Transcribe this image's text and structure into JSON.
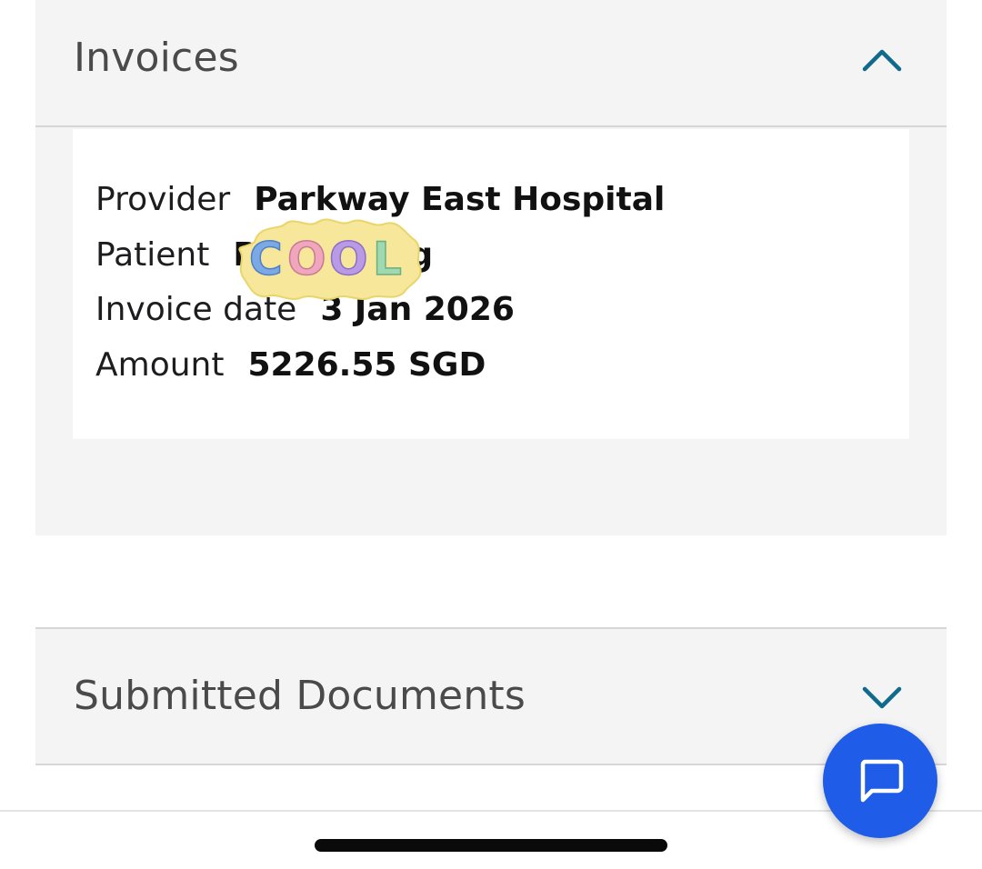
{
  "invoices_section": {
    "title": "Invoices",
    "expanded": true,
    "toggle_icon": "chevron-up-icon",
    "invoice": {
      "provider_label": "Provider",
      "provider_value": "Parkway East Hospital",
      "patient_label": "Patient",
      "patient_value": "P",
      "patient_value_end": "ng",
      "patient_sticker": "COOL",
      "invoice_date_label": "Invoice date",
      "invoice_date_value": "3 Jan 2026",
      "amount_label": "Amount",
      "amount_value": "5226.55 SGD"
    }
  },
  "submitted_documents_section": {
    "title": "Submitted Documents",
    "expanded": false,
    "toggle_icon": "chevron-down-icon"
  },
  "chat_button": {
    "icon": "chat-bubble-icon",
    "color": "#1f5ce8"
  },
  "colors": {
    "accent": "#0f6a8c",
    "panel_background": "#f4f4f4",
    "fab": "#1f5ce8"
  }
}
